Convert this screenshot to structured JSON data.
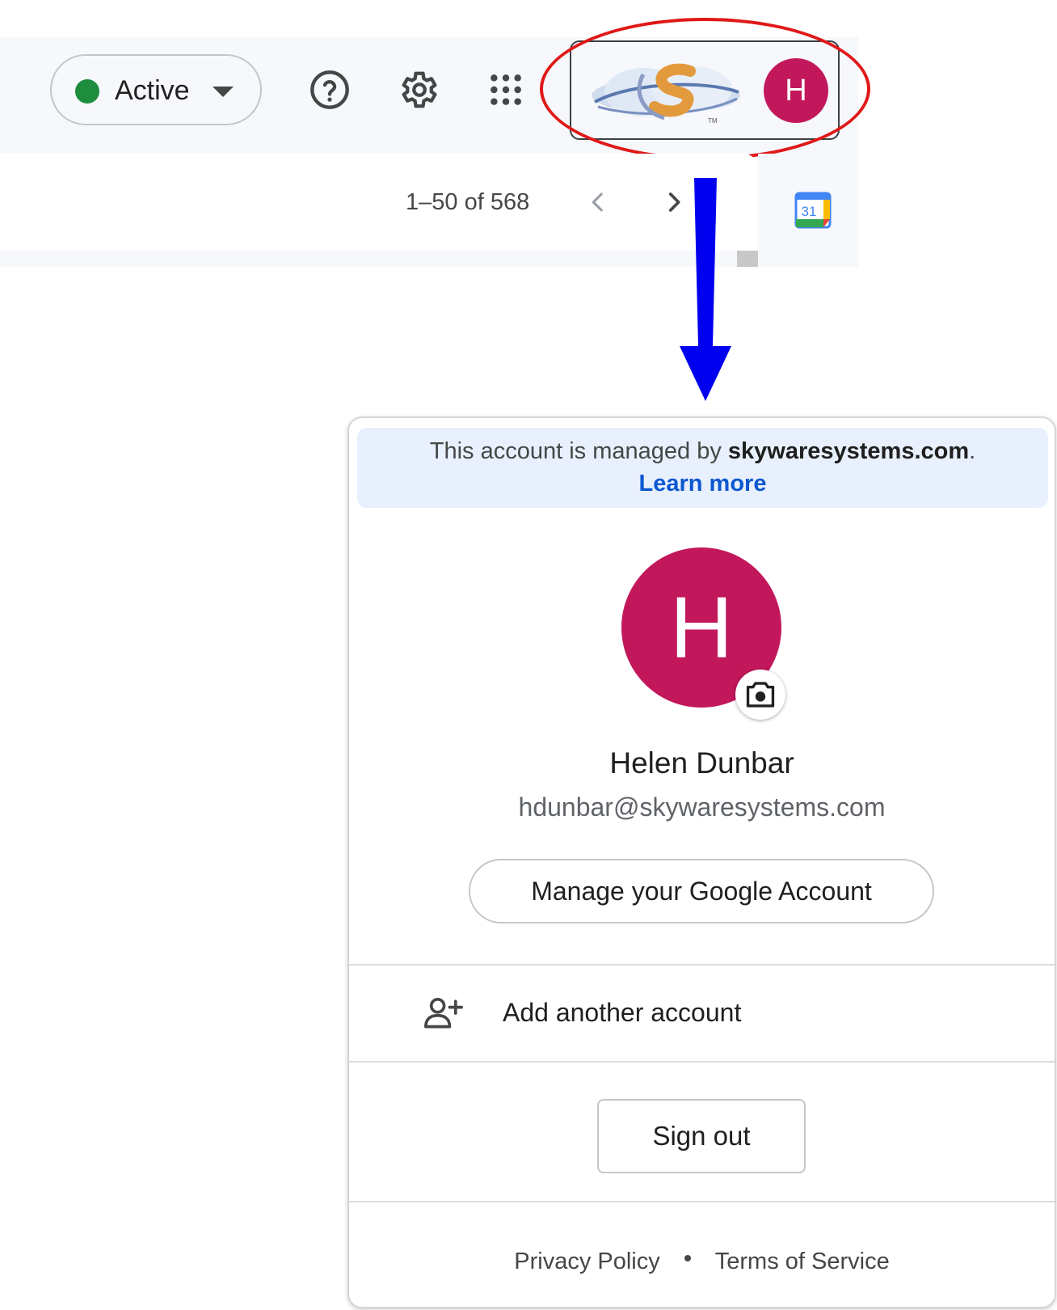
{
  "toolbar": {
    "status_label": "Active",
    "status_color": "#1e8e3e",
    "help_icon": "help-circle-icon",
    "settings_icon": "gear-icon",
    "apps_icon": "apps-grid-icon",
    "account_initial": "H",
    "avatar_color": "#c2185b"
  },
  "pager": {
    "range_text": "1–50 of 568",
    "calendar_day": "31"
  },
  "annotation": {
    "ellipse_color": "#e01818",
    "arrow_color": "#0000ee"
  },
  "account_menu": {
    "managed_prefix": "This account is managed by ",
    "managed_domain": "skywaresystems.com",
    "managed_suffix": ".",
    "learn_more": "Learn more",
    "avatar_initial": "H",
    "user_name": "Helen Dunbar",
    "user_email": "hdunbar@skywaresystems.com",
    "manage_account": "Manage your Google Account",
    "add_account": "Add another account",
    "sign_out": "Sign out",
    "privacy_policy": "Privacy Policy",
    "terms_of_service": "Terms of Service"
  }
}
